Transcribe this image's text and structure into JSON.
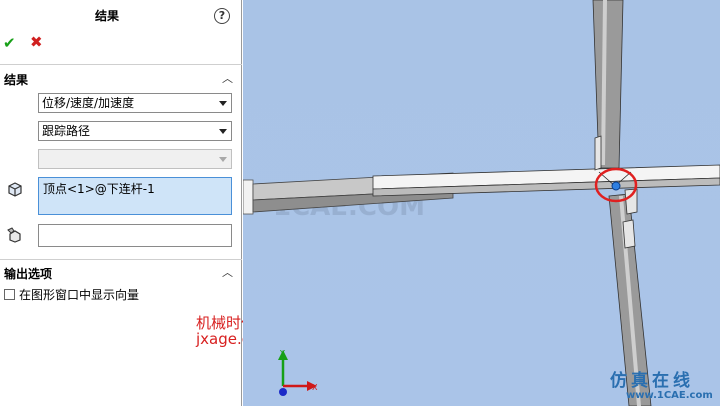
{
  "panel": {
    "title": "结果",
    "help_label": "?",
    "ok_label": "✔",
    "cancel_label": "✖"
  },
  "results_section": {
    "title": "结果",
    "collapse_label": "︿",
    "result_type": "位移/速度/加速度",
    "sub_type": "跟踪路径",
    "component": "",
    "vertex_selection": "顶点<1>@下连杆-1",
    "second_selection": ""
  },
  "output_section": {
    "title": "输出选项",
    "collapse_label": "︿",
    "show_vector_label": "在图形窗口中显示向量",
    "show_vector_checked": false
  },
  "watermarks": {
    "cn": "机械时代网",
    "url": "jxage.com",
    "site_cn": "仿真在线",
    "site_url": "www.1CAE.com",
    "bg": "1CAE.COM"
  },
  "triad": {
    "x_label": "X",
    "y_label": "Y"
  },
  "colors": {
    "viewport_bg": "#aac4e8",
    "accent_selection": "#cfe4f8",
    "highlight_circle": "#e02020",
    "ok": "#18a018",
    "cancel": "#d02020"
  }
}
